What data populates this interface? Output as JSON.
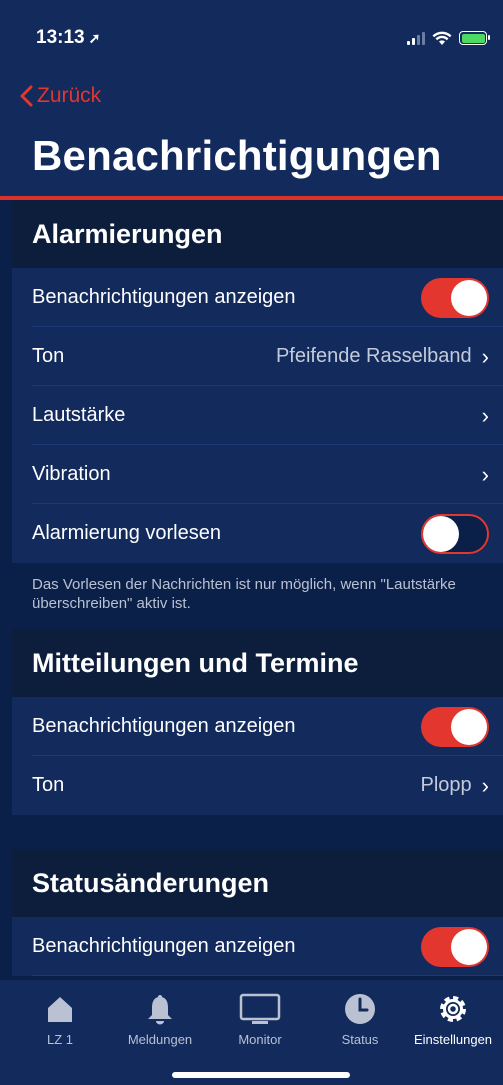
{
  "status_bar": {
    "time": "13:13",
    "location_icon": "location-arrow-icon"
  },
  "nav": {
    "back_label": "Zurück",
    "title": "Benachrichtigungen"
  },
  "sections": {
    "alarm": {
      "title": "Alarmierungen",
      "rows": {
        "show": {
          "label": "Benachrichtigungen anzeigen",
          "toggle": "on"
        },
        "tone": {
          "label": "Ton",
          "value": "Pfeifende Rasselband"
        },
        "volume": {
          "label": "Lautstärke"
        },
        "vibration": {
          "label": "Vibration"
        },
        "read_aloud": {
          "label": "Alarmierung vorlesen",
          "toggle": "off"
        }
      },
      "footnote": "Das Vorlesen der Nachrichten ist nur möglich, wenn \"Lautstärke überschreiben\" aktiv ist."
    },
    "messages": {
      "title": "Mitteilungen und Termine",
      "rows": {
        "show": {
          "label": "Benachrichtigungen anzeigen",
          "toggle": "on"
        },
        "tone": {
          "label": "Ton",
          "value": "Plopp"
        }
      }
    },
    "status": {
      "title": "Statusänderungen",
      "rows": {
        "show": {
          "label": "Benachrichtigungen anzeigen",
          "toggle": "on"
        }
      }
    }
  },
  "tabbar": {
    "tabs": [
      {
        "label": "LZ 1",
        "icon": "house-icon"
      },
      {
        "label": "Meldungen",
        "icon": "bell-icon"
      },
      {
        "label": "Monitor",
        "icon": "monitor-icon"
      },
      {
        "label": "Status",
        "icon": "clock-icon"
      },
      {
        "label": "Einstellungen",
        "icon": "gear-icon"
      }
    ],
    "active": "Einstellungen"
  },
  "colors": {
    "accent": "#e2362f",
    "background": "#0b2048",
    "panel": "#122a5c",
    "section_header": "#0d1d3c"
  }
}
